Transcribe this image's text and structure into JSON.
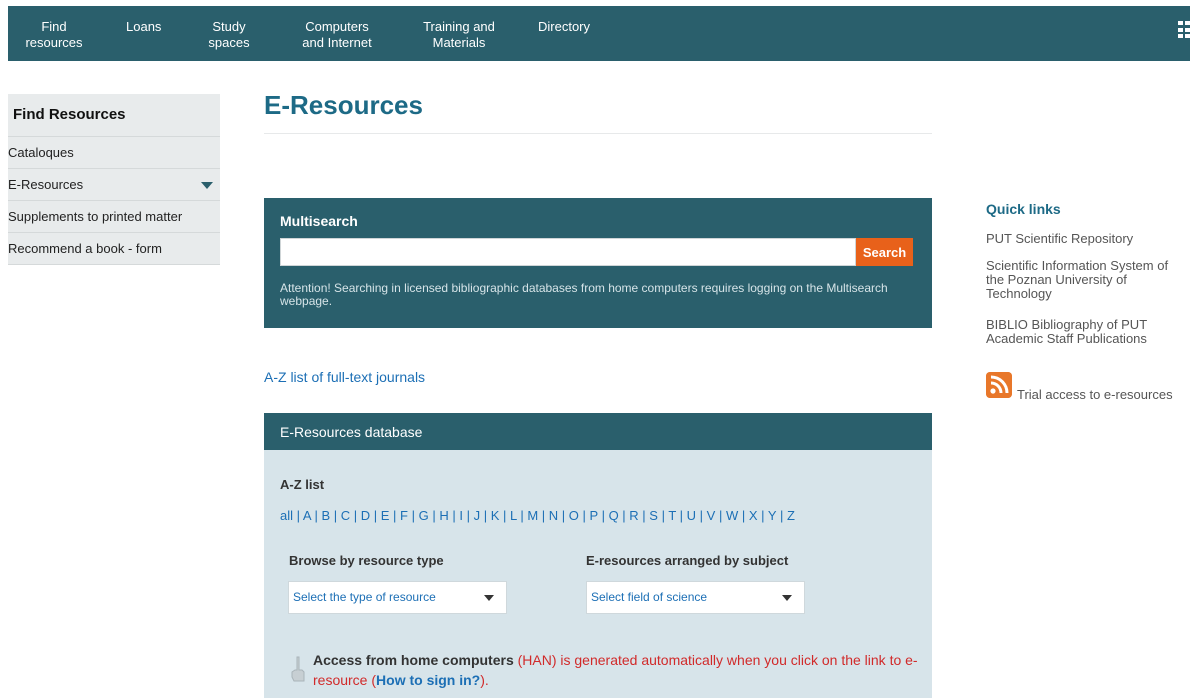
{
  "nav": {
    "items": [
      {
        "label": "Find\nresources"
      },
      {
        "label": "Loans"
      },
      {
        "label": "Study\nspaces"
      },
      {
        "label": "Computers\nand Internet"
      },
      {
        "label": "Training and\nMaterials"
      },
      {
        "label": "Directory"
      }
    ],
    "icon": "grid-menu-icon"
  },
  "sidebar": {
    "heading": "Find Resources",
    "items": [
      {
        "label": "Cataloques"
      },
      {
        "label": "E-Resources",
        "icon": "chevron-down-icon"
      },
      {
        "label": "Supplements to printed matter"
      },
      {
        "label": "Recommend a book - form"
      }
    ]
  },
  "main": {
    "title": "E-Resources",
    "multisearch": {
      "title": "Multisearch",
      "input_value": "",
      "button": "Search",
      "note": "Attention! Searching in licensed bibliographic databases from home computers requires logging on the Multisearch webpage."
    },
    "az_journals_link": "A-Z list of full-text journals",
    "eresources": {
      "heading": "E-Resources database",
      "az_label": "A-Z list",
      "letters": [
        "all",
        "A",
        "B",
        "C",
        "D",
        "E",
        "F",
        "G",
        "H",
        "I",
        "J",
        "K",
        "L",
        "M",
        "N",
        "O",
        "P",
        "Q",
        "R",
        "S",
        "T",
        "U",
        "V",
        "W",
        "X",
        "Y",
        "Z"
      ],
      "browse_type_heading": "Browse by resource type",
      "browse_type_select": "Select the type of resource",
      "subject_heading": "E-resources arranged by subject",
      "subject_select": "Select field of science",
      "access_bold": "Access from home computers",
      "access_rest": " (HAN) is generated automatically when you click on the link to e-resource (",
      "access_link": "How to sign in?",
      "access_end": ")."
    }
  },
  "right": {
    "quick_title": "Quick links",
    "links": [
      {
        "label": "PUT Scientific Repository"
      },
      {
        "label": "Scientific Information System of the Poznan University of Technology"
      },
      {
        "label": "BIBLIO Bibliography of PUT Academic Staff Publications"
      }
    ],
    "trial": "Trial access to e-resources",
    "trial_icon": "rss-icon"
  },
  "colors": {
    "nav": "#2a5f6c",
    "title": "#1d6a86",
    "link": "#1c6fb5",
    "search_button": "#e8611a",
    "notice": "#d12a2a"
  }
}
